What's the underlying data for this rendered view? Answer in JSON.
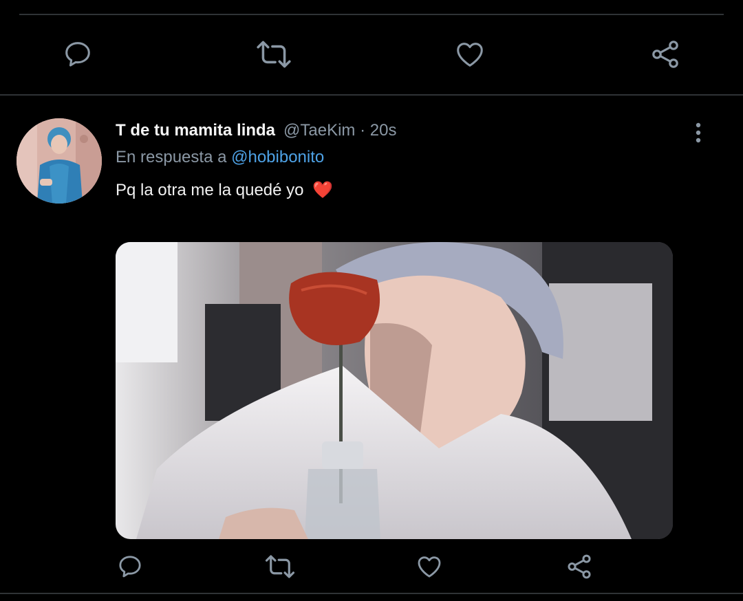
{
  "previous_tweet": {
    "actions": [
      {
        "name": "reply",
        "icon": "reply-icon"
      },
      {
        "name": "retweet",
        "icon": "retweet-icon"
      },
      {
        "name": "like",
        "icon": "heart-icon"
      },
      {
        "name": "share",
        "icon": "share-icon"
      }
    ]
  },
  "tweet": {
    "display_name": "T de tu mamita linda",
    "handle_time": "@TaeKim · 20s",
    "reply_prefix": "En respuesta a",
    "reply_to": "@hobibonito",
    "text": "Pq la otra me la quedé yo",
    "emoji": "❤️",
    "more_icon": "more-vertical-icon",
    "actions": [
      {
        "name": "reply",
        "icon": "reply-icon"
      },
      {
        "name": "retweet",
        "icon": "retweet-icon"
      },
      {
        "name": "like",
        "icon": "heart-icon"
      },
      {
        "name": "share",
        "icon": "share-icon"
      }
    ]
  },
  "colors": {
    "background": "#000000",
    "divider": "#2f3336",
    "secondary_text": "#8b98a5",
    "link": "#4ea2e6",
    "primary_text": "#f2f2f2",
    "heart_emoji": "#e0142a"
  }
}
